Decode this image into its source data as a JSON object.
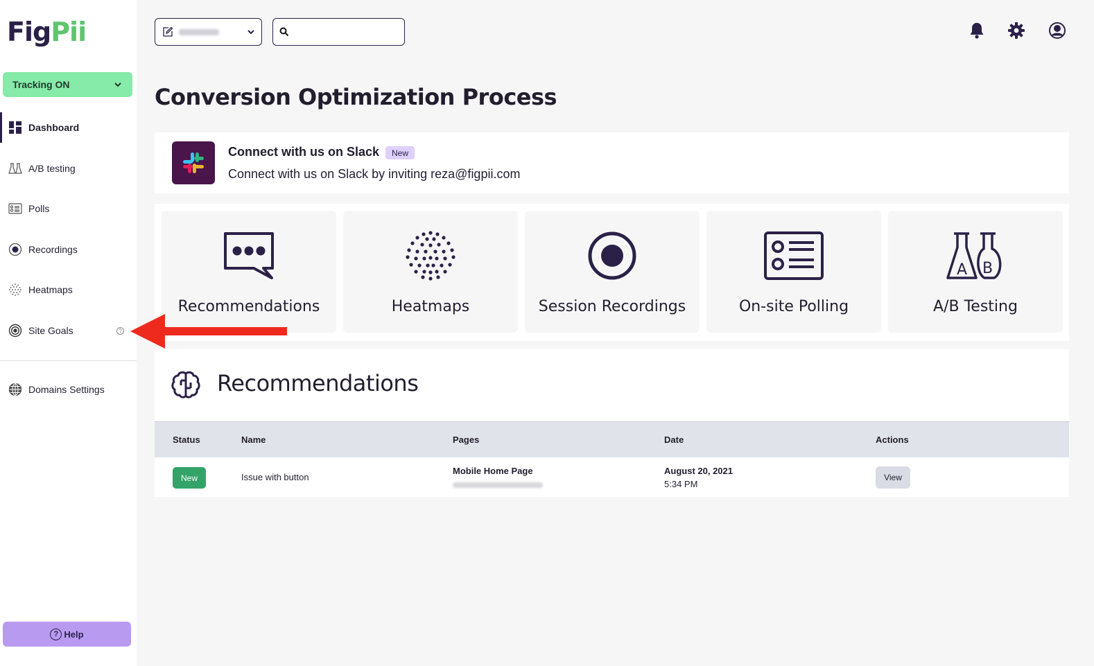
{
  "brand": {
    "name_part1": "Fig",
    "name_part2": "Pii",
    "primary_color": "#2b2148",
    "accent_green": "#5fc56f"
  },
  "sidebar": {
    "tracking_label": "Tracking ON",
    "items": [
      {
        "label": "Dashboard",
        "icon": "dashboard-icon",
        "active": true
      },
      {
        "label": "A/B testing",
        "icon": "flask-icon"
      },
      {
        "label": "Polls",
        "icon": "poll-icon"
      },
      {
        "label": "Recordings",
        "icon": "record-icon"
      },
      {
        "label": "Heatmaps",
        "icon": "heatmap-icon"
      },
      {
        "label": "Site Goals",
        "icon": "target-icon",
        "help_glyph": "?"
      }
    ],
    "settings_label": "Domains Settings",
    "help_label": "Help",
    "help_glyph": "?"
  },
  "topbar": {
    "search_placeholder": "",
    "search_value": ""
  },
  "page": {
    "title": "Conversion Optimization Process"
  },
  "slack": {
    "title": "Connect with us on Slack",
    "badge": "New",
    "subtitle": "Connect with us on Slack by inviting reza@figpii.com"
  },
  "features": [
    {
      "label": "Recommendations",
      "icon": "chat-bubble-icon"
    },
    {
      "label": "Heatmaps",
      "icon": "heatmap-dots-icon"
    },
    {
      "label": "Session Recordings",
      "icon": "record-icon"
    },
    {
      "label": "On-site Polling",
      "icon": "poll-form-icon"
    },
    {
      "label": "A/B Testing",
      "icon": "ab-flask-icon"
    }
  ],
  "recommendations": {
    "title": "Recommendations",
    "columns": [
      "Status",
      "Name",
      "Pages",
      "Date",
      "Actions"
    ],
    "rows": [
      {
        "status": "New",
        "name": "Issue with button",
        "page": "Mobile Home Page",
        "date": "August 20, 2021",
        "time": "5:34 PM",
        "action": "View"
      }
    ]
  },
  "annotation": {
    "color": "#ee2a1f",
    "points_to": "Site Goals"
  }
}
